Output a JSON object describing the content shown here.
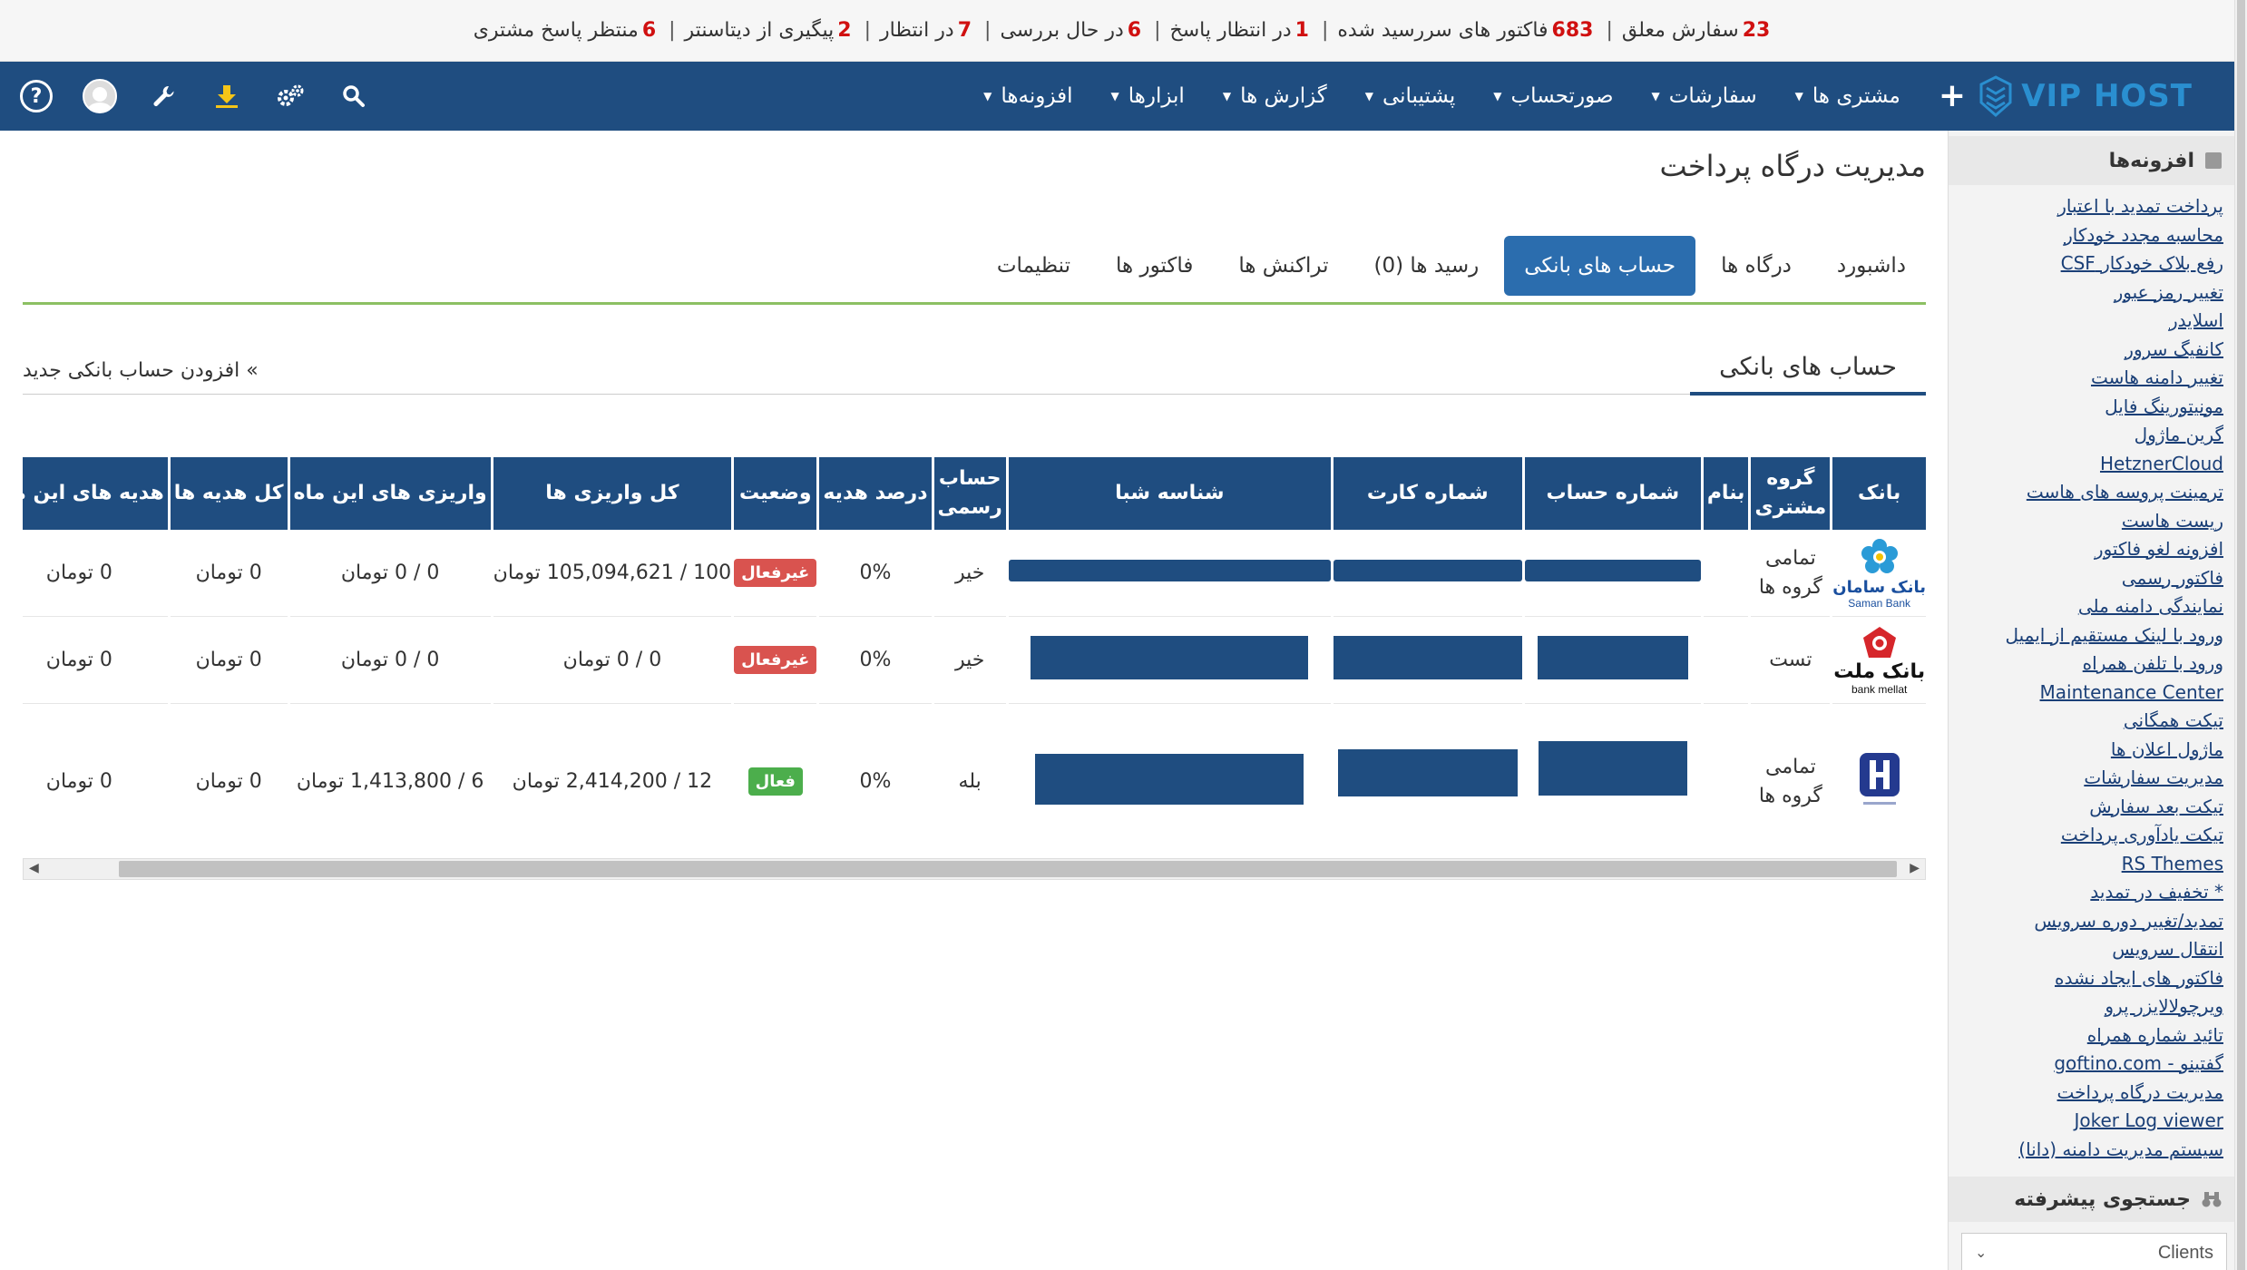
{
  "status_bar": {
    "pending_orders_num": "23",
    "pending_orders_text": "سفارش معلق",
    "overdue_invoices_num": "683",
    "overdue_invoices_text": "فاکتور های سررسید شده",
    "awaiting_reply_num": "1",
    "awaiting_reply_text": "در انتظار پاسخ",
    "in_review_num": "6",
    "in_review_text": "در حال بررسی",
    "waiting_num": "7",
    "waiting_text": "در انتظار",
    "datacenter_num": "2",
    "datacenter_text": "پیگیری از دیتاسنتر",
    "customer_reply_num": "6",
    "customer_reply_text": "منتظر پاسخ مشتری"
  },
  "navbar": {
    "logo_vip": "VIP",
    "logo_host": "HOST",
    "plus": "+",
    "items": [
      "مشتری ها",
      "سفارشات",
      "صورتحساب",
      "پشتیبانی",
      "گزارش ها",
      "ابزارها",
      "افزونه‌ها"
    ],
    "help": "?"
  },
  "page": {
    "title": "مدیریت درگاه پرداخت"
  },
  "tabs": [
    {
      "label": "داشبورد",
      "active": false
    },
    {
      "label": "درگاه ها",
      "active": false
    },
    {
      "label": "حساب های بانکی",
      "active": true
    },
    {
      "label": "رسید ها (0)",
      "active": false
    },
    {
      "label": "تراکنش ها",
      "active": false
    },
    {
      "label": "فاکتور ها",
      "active": false
    },
    {
      "label": "تنظیمات",
      "active": false
    }
  ],
  "section": {
    "title": "حساب های بانکی",
    "add_link": "» افزودن حساب بانکی جدید"
  },
  "table": {
    "headers": [
      "بانک",
      "گروه مشتری",
      "بنام",
      "شماره حساب",
      "شماره کارت",
      "شناسه شبا",
      "حساب رسمی",
      "درصد هدیه",
      "وضعیت",
      "کل واریزی ها",
      "واریزی های این ماه",
      "کل هدیه ها",
      "هدیه های این ماه"
    ],
    "rows": [
      {
        "bank_name": "بانک سامان",
        "bank_sub": "Saman Bank",
        "group": "تمامی گروه ها",
        "name": "",
        "official": "خیر",
        "gift_percent": "0%",
        "status": "غیرفعال",
        "total_deposits": "100 / 105,094,621 تومان",
        "month_deposits": "0 / 0 تومان",
        "total_gifts": "0 تومان",
        "month_gifts": "0 تومان"
      },
      {
        "bank_name": "بانک ملت",
        "bank_sub": "bank mellat",
        "group": "تست",
        "name": "",
        "official": "خیر",
        "gift_percent": "0%",
        "status": "غیرفعال",
        "total_deposits": "0 / 0 تومان",
        "month_deposits": "0 / 0 تومان",
        "total_gifts": "0 تومان",
        "month_gifts": "0 تومان"
      },
      {
        "bank_name": "",
        "bank_sub": "",
        "group": "تمامی گروه ها",
        "name": "",
        "official": "بله",
        "gift_percent": "0%",
        "status": "فعال",
        "total_deposits": "12 / 2,414,200 تومان",
        "month_deposits": "6 / 1,413,800 تومان",
        "total_gifts": "0 تومان",
        "month_gifts": "0 تومان"
      }
    ]
  },
  "sidebar": {
    "addons_title": "افزونه‌ها",
    "links": [
      "پرداخت تمدید با اعتبار",
      "محاسبه مجدد خودکار",
      "رفع بلاک خودکار CSF",
      "تغییر رمز عبور",
      "اسلایدر",
      "کانفیگ سرور",
      "تغییر دامنه هاست",
      "مونیتورینگ فایل",
      "گرین ماژول",
      "HetznerCloud",
      "ترمینت پروسه های هاست",
      "ریست هاست",
      "افزونه لغو فاکتور",
      "فاکتور رسمی",
      "نمایندگی دامنه ملی",
      "ورود با لینک مستقیم از ایمیل",
      "ورود با تلفن همراه",
      "Maintenance Center",
      "تیکت همگانی",
      "ماژول اعلان ها",
      "مدیریت سفارشات",
      "تیکت بعد سفارش",
      "تیکت یادآوری پرداخت",
      "RS Themes",
      "* تخفیف در تمدید",
      "تمدید/تغییر دوره سرویس",
      "انتقال سرویس",
      "فاکتور های ایجاد نشده",
      "ویرچولالایزر پرو",
      "تائید شماره همراه",
      "گفتینو - goftino.com",
      "مدیریت درگاه پرداخت",
      "Joker Log viewer",
      "سیستم مدیریت دامنه (دانا)"
    ],
    "search_title": "جستجوی پیشرفته",
    "search_select": "Clients"
  },
  "colors": {
    "navbar": "#1f4d80",
    "tab_active": "#2b6dae",
    "badge_off": "#d9534f",
    "badge_on": "#4cae4c",
    "status_num": "#d01010",
    "tabs_line": "#8cc063"
  }
}
